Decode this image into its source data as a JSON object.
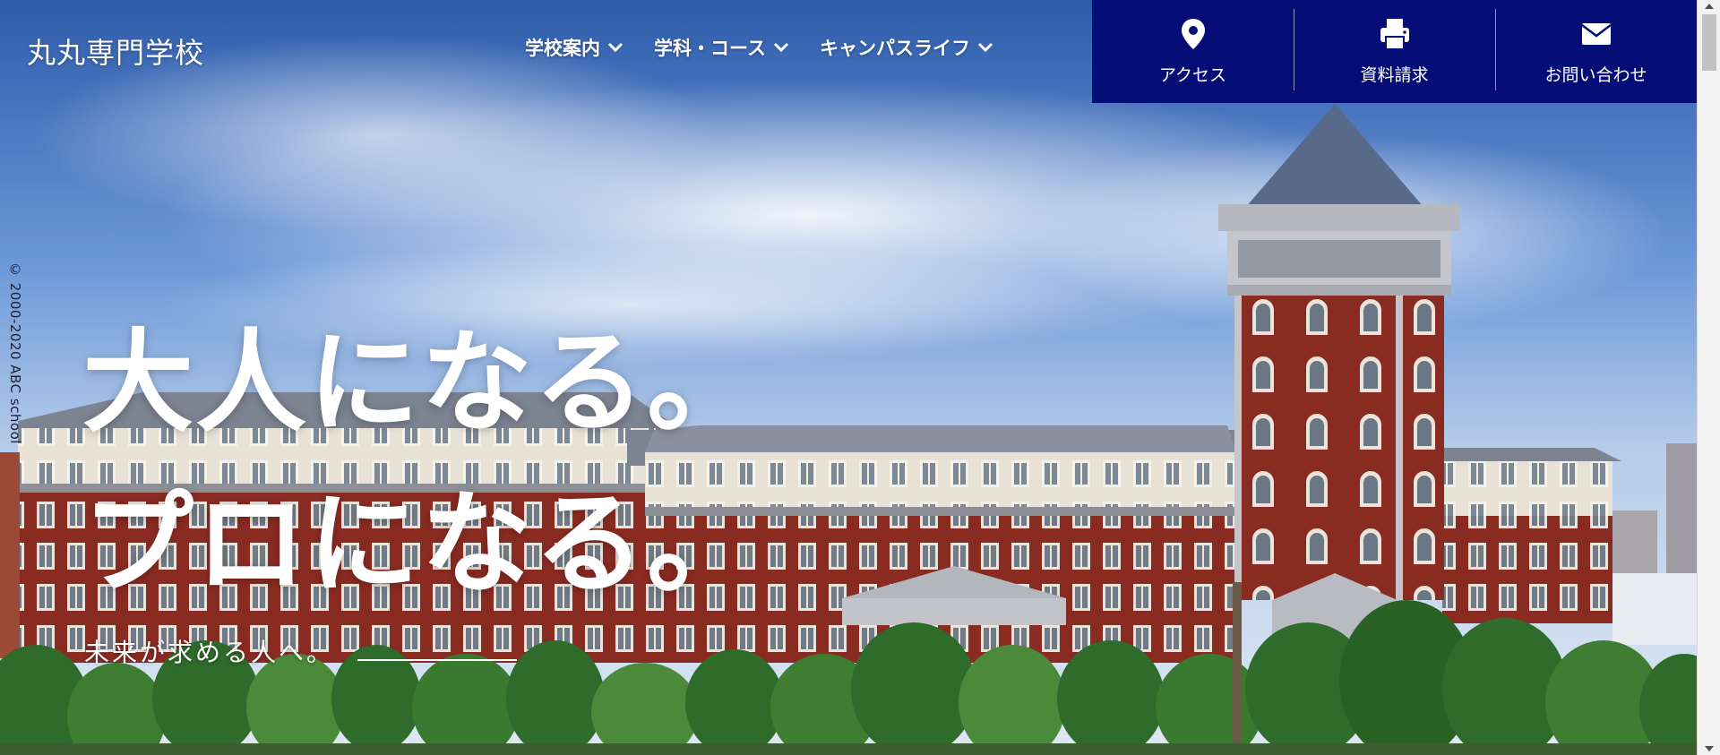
{
  "brand": {
    "logo_text": "丸丸専門学校"
  },
  "nav": {
    "items": [
      {
        "label": "学校案内"
      },
      {
        "label": "学科・コース"
      },
      {
        "label": "キャンパスライフ"
      }
    ]
  },
  "cta": {
    "items": [
      {
        "label": "アクセス",
        "icon": "map-pin-icon"
      },
      {
        "label": "資料請求",
        "icon": "printer-icon"
      },
      {
        "label": "お問い合わせ",
        "icon": "envelope-icon"
      }
    ]
  },
  "hero": {
    "headline_line1": "大人になる。",
    "headline_line2": "プロになる。",
    "tagline": "未来が求める人へ。",
    "copyright": "© 2000-2020 ABC school"
  },
  "colors": {
    "cta_background": "#050e77",
    "text_on_hero": "#ffffff",
    "brick": "#8a2b22",
    "sky": "#4a78c2"
  }
}
